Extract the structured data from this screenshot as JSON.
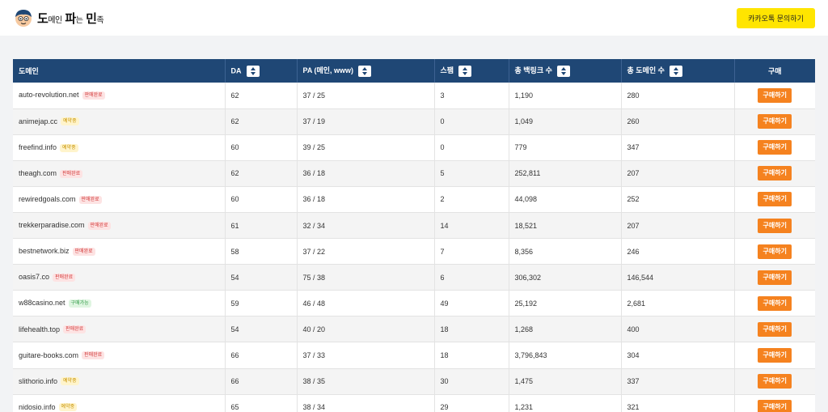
{
  "header": {
    "logo_parts": [
      "도",
      "메인",
      "파",
      "는",
      "민",
      "족"
    ],
    "kakao_button": "카카오톡 문의하기"
  },
  "table": {
    "columns": [
      "도메인",
      "DA",
      "PA (메인, www)",
      "스팸",
      "총 백링크 수",
      "총 도메인 수",
      "구매"
    ],
    "buy_label": "구매하기",
    "status_colors": {
      "판매완료": "#d33b3b",
      "예약중": "#c79200",
      "구매가능": "#2f9a45"
    },
    "rows": [
      {
        "domain": "auto-revolution.net",
        "status": "판매완료",
        "da": "62",
        "pa": "37 / 25",
        "spam": "3",
        "backlinks": "1,190",
        "domains": "280"
      },
      {
        "domain": "animejap.cc",
        "status": "예약중",
        "da": "62",
        "pa": "37 / 19",
        "spam": "0",
        "backlinks": "1,049",
        "domains": "260"
      },
      {
        "domain": "freefind.info",
        "status": "예약중",
        "da": "60",
        "pa": "39 / 25",
        "spam": "0",
        "backlinks": "779",
        "domains": "347"
      },
      {
        "domain": "theagh.com",
        "status": "판매완료",
        "da": "62",
        "pa": "36 / 18",
        "spam": "5",
        "backlinks": "252,811",
        "domains": "207"
      },
      {
        "domain": "rewiredgoals.com",
        "status": "판매완료",
        "da": "60",
        "pa": "36 / 18",
        "spam": "2",
        "backlinks": "44,098",
        "domains": "252"
      },
      {
        "domain": "trekkerparadise.com",
        "status": "판매완료",
        "da": "61",
        "pa": "32 / 34",
        "spam": "14",
        "backlinks": "18,521",
        "domains": "207"
      },
      {
        "domain": "bestnetwork.biz",
        "status": "판매완료",
        "da": "58",
        "pa": "37 / 22",
        "spam": "7",
        "backlinks": "8,356",
        "domains": "246"
      },
      {
        "domain": "oasis7.co",
        "status": "판매완료",
        "da": "54",
        "pa": "75 / 38",
        "spam": "6",
        "backlinks": "306,302",
        "domains": "146,544"
      },
      {
        "domain": "w88casino.net",
        "status": "구매가능",
        "da": "59",
        "pa": "46 / 48",
        "spam": "49",
        "backlinks": "25,192",
        "domains": "2,681"
      },
      {
        "domain": "lifehealth.top",
        "status": "판매완료",
        "da": "54",
        "pa": "40 / 20",
        "spam": "18",
        "backlinks": "1,268",
        "domains": "400"
      },
      {
        "domain": "guitare-books.com",
        "status": "판매완료",
        "da": "66",
        "pa": "37 / 33",
        "spam": "18",
        "backlinks": "3,796,843",
        "domains": "304"
      },
      {
        "domain": "slithorio.info",
        "status": "예약중",
        "da": "66",
        "pa": "38 / 35",
        "spam": "30",
        "backlinks": "1,475",
        "domains": "337"
      },
      {
        "domain": "nidosio.info",
        "status": "예약중",
        "da": "65",
        "pa": "38 / 34",
        "spam": "29",
        "backlinks": "1,231",
        "domains": "321"
      }
    ]
  }
}
